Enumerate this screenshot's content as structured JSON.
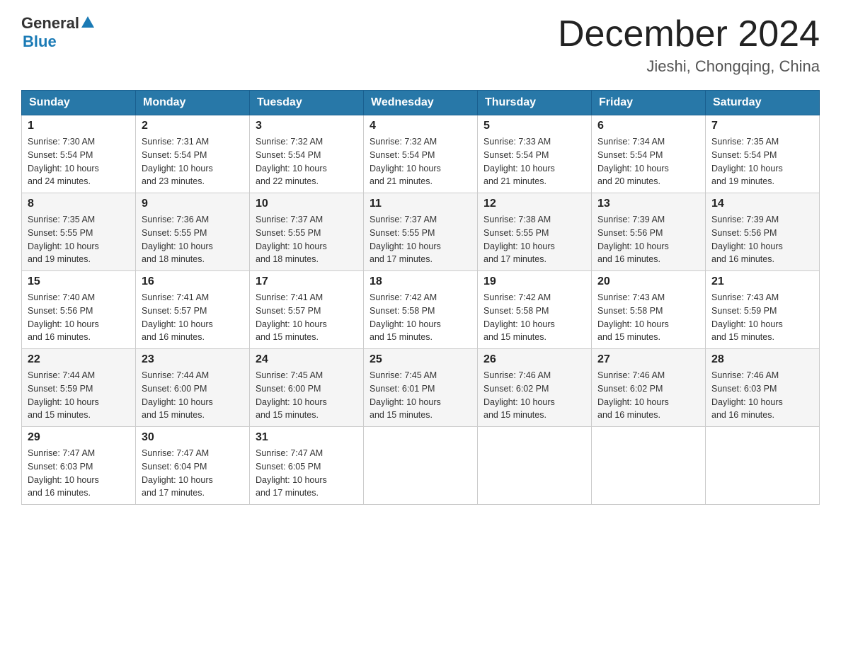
{
  "header": {
    "logo_general": "General",
    "logo_blue": "Blue",
    "month_title": "December 2024",
    "location": "Jieshi, Chongqing, China"
  },
  "days_of_week": [
    "Sunday",
    "Monday",
    "Tuesday",
    "Wednesday",
    "Thursday",
    "Friday",
    "Saturday"
  ],
  "weeks": [
    [
      {
        "day": "1",
        "sunrise": "7:30 AM",
        "sunset": "5:54 PM",
        "daylight": "10 hours and 24 minutes."
      },
      {
        "day": "2",
        "sunrise": "7:31 AM",
        "sunset": "5:54 PM",
        "daylight": "10 hours and 23 minutes."
      },
      {
        "day": "3",
        "sunrise": "7:32 AM",
        "sunset": "5:54 PM",
        "daylight": "10 hours and 22 minutes."
      },
      {
        "day": "4",
        "sunrise": "7:32 AM",
        "sunset": "5:54 PM",
        "daylight": "10 hours and 21 minutes."
      },
      {
        "day": "5",
        "sunrise": "7:33 AM",
        "sunset": "5:54 PM",
        "daylight": "10 hours and 21 minutes."
      },
      {
        "day": "6",
        "sunrise": "7:34 AM",
        "sunset": "5:54 PM",
        "daylight": "10 hours and 20 minutes."
      },
      {
        "day": "7",
        "sunrise": "7:35 AM",
        "sunset": "5:54 PM",
        "daylight": "10 hours and 19 minutes."
      }
    ],
    [
      {
        "day": "8",
        "sunrise": "7:35 AM",
        "sunset": "5:55 PM",
        "daylight": "10 hours and 19 minutes."
      },
      {
        "day": "9",
        "sunrise": "7:36 AM",
        "sunset": "5:55 PM",
        "daylight": "10 hours and 18 minutes."
      },
      {
        "day": "10",
        "sunrise": "7:37 AM",
        "sunset": "5:55 PM",
        "daylight": "10 hours and 18 minutes."
      },
      {
        "day": "11",
        "sunrise": "7:37 AM",
        "sunset": "5:55 PM",
        "daylight": "10 hours and 17 minutes."
      },
      {
        "day": "12",
        "sunrise": "7:38 AM",
        "sunset": "5:55 PM",
        "daylight": "10 hours and 17 minutes."
      },
      {
        "day": "13",
        "sunrise": "7:39 AM",
        "sunset": "5:56 PM",
        "daylight": "10 hours and 16 minutes."
      },
      {
        "day": "14",
        "sunrise": "7:39 AM",
        "sunset": "5:56 PM",
        "daylight": "10 hours and 16 minutes."
      }
    ],
    [
      {
        "day": "15",
        "sunrise": "7:40 AM",
        "sunset": "5:56 PM",
        "daylight": "10 hours and 16 minutes."
      },
      {
        "day": "16",
        "sunrise": "7:41 AM",
        "sunset": "5:57 PM",
        "daylight": "10 hours and 16 minutes."
      },
      {
        "day": "17",
        "sunrise": "7:41 AM",
        "sunset": "5:57 PM",
        "daylight": "10 hours and 15 minutes."
      },
      {
        "day": "18",
        "sunrise": "7:42 AM",
        "sunset": "5:58 PM",
        "daylight": "10 hours and 15 minutes."
      },
      {
        "day": "19",
        "sunrise": "7:42 AM",
        "sunset": "5:58 PM",
        "daylight": "10 hours and 15 minutes."
      },
      {
        "day": "20",
        "sunrise": "7:43 AM",
        "sunset": "5:58 PM",
        "daylight": "10 hours and 15 minutes."
      },
      {
        "day": "21",
        "sunrise": "7:43 AM",
        "sunset": "5:59 PM",
        "daylight": "10 hours and 15 minutes."
      }
    ],
    [
      {
        "day": "22",
        "sunrise": "7:44 AM",
        "sunset": "5:59 PM",
        "daylight": "10 hours and 15 minutes."
      },
      {
        "day": "23",
        "sunrise": "7:44 AM",
        "sunset": "6:00 PM",
        "daylight": "10 hours and 15 minutes."
      },
      {
        "day": "24",
        "sunrise": "7:45 AM",
        "sunset": "6:00 PM",
        "daylight": "10 hours and 15 minutes."
      },
      {
        "day": "25",
        "sunrise": "7:45 AM",
        "sunset": "6:01 PM",
        "daylight": "10 hours and 15 minutes."
      },
      {
        "day": "26",
        "sunrise": "7:46 AM",
        "sunset": "6:02 PM",
        "daylight": "10 hours and 15 minutes."
      },
      {
        "day": "27",
        "sunrise": "7:46 AM",
        "sunset": "6:02 PM",
        "daylight": "10 hours and 16 minutes."
      },
      {
        "day": "28",
        "sunrise": "7:46 AM",
        "sunset": "6:03 PM",
        "daylight": "10 hours and 16 minutes."
      }
    ],
    [
      {
        "day": "29",
        "sunrise": "7:47 AM",
        "sunset": "6:03 PM",
        "daylight": "10 hours and 16 minutes."
      },
      {
        "day": "30",
        "sunrise": "7:47 AM",
        "sunset": "6:04 PM",
        "daylight": "10 hours and 17 minutes."
      },
      {
        "day": "31",
        "sunrise": "7:47 AM",
        "sunset": "6:05 PM",
        "daylight": "10 hours and 17 minutes."
      },
      null,
      null,
      null,
      null
    ]
  ],
  "labels": {
    "sunrise": "Sunrise:",
    "sunset": "Sunset:",
    "daylight": "Daylight:"
  }
}
